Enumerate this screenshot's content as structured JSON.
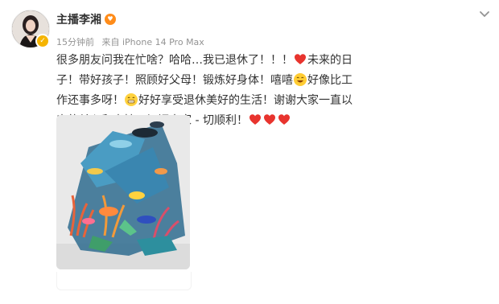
{
  "post": {
    "username": "主播李湘",
    "time": "15分钟前",
    "source": "来自 iPhone 14 Pro Max",
    "text": {
      "p1": "很多朋友问我在忙啥？哈哈…我已退休了！！！",
      "p2": "未来的日子！带好孩子！照顾好父母！锻炼好身体！嘻嘻",
      "p3": "好像比工作还事多呀！",
      "p4": "好好享受退休美好的生活！谢谢大家一直以来的关心和支持！祝福大家 - 切顺利！"
    },
    "icons": {
      "more": "chevron-down-icon",
      "verified": "verified-badge-icon",
      "member": "member-badge-icon",
      "heart": "red-heart-emoji",
      "laugh": "laughing-emoji",
      "grin": "grinning-emoji"
    },
    "colors": {
      "text": "#333333",
      "meta": "#939393",
      "heart": "#e8342e",
      "verified": "#f5b400"
    }
  }
}
